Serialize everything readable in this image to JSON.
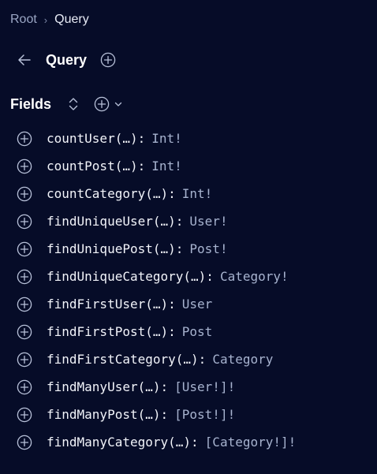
{
  "breadcrumb": {
    "root": "Root",
    "separator": "›",
    "current": "Query"
  },
  "header": {
    "title": "Query",
    "back_icon": "arrow-left-icon",
    "add_icon": "plus-circle-icon"
  },
  "section": {
    "title": "Fields",
    "sort_icon": "sort-icon",
    "add_icon": "plus-circle-icon",
    "dropdown_icon": "chevron-down-icon"
  },
  "fields": [
    {
      "name": "countUser",
      "args": "(…)",
      "colon": ":",
      "type": "Int!"
    },
    {
      "name": "countPost",
      "args": "(…)",
      "colon": ":",
      "type": "Int!"
    },
    {
      "name": "countCategory",
      "args": "(…)",
      "colon": ":",
      "type": "Int!"
    },
    {
      "name": "findUniqueUser",
      "args": "(…)",
      "colon": ":",
      "type": "User!"
    },
    {
      "name": "findUniquePost",
      "args": "(…)",
      "colon": ":",
      "type": "Post!"
    },
    {
      "name": "findUniqueCategory",
      "args": "(…)",
      "colon": ":",
      "type": "Category!"
    },
    {
      "name": "findFirstUser",
      "args": "(…)",
      "colon": ":",
      "type": "User"
    },
    {
      "name": "findFirstPost",
      "args": "(…)",
      "colon": ":",
      "type": "Post"
    },
    {
      "name": "findFirstCategory",
      "args": "(…)",
      "colon": ":",
      "type": "Category"
    },
    {
      "name": "findManyUser",
      "args": "(…)",
      "colon": ":",
      "type": "[User!]!"
    },
    {
      "name": "findManyPost",
      "args": "(…)",
      "colon": ":",
      "type": "[Post!]!"
    },
    {
      "name": "findManyCategory",
      "args": "(…)",
      "colon": ":",
      "type": "[Category!]!"
    }
  ],
  "colors": {
    "background": "#060c28",
    "text": "#f2f4fa",
    "type_text": "#a7b3cf",
    "muted": "#9aa6c4",
    "icon": "#b7c0d8"
  }
}
